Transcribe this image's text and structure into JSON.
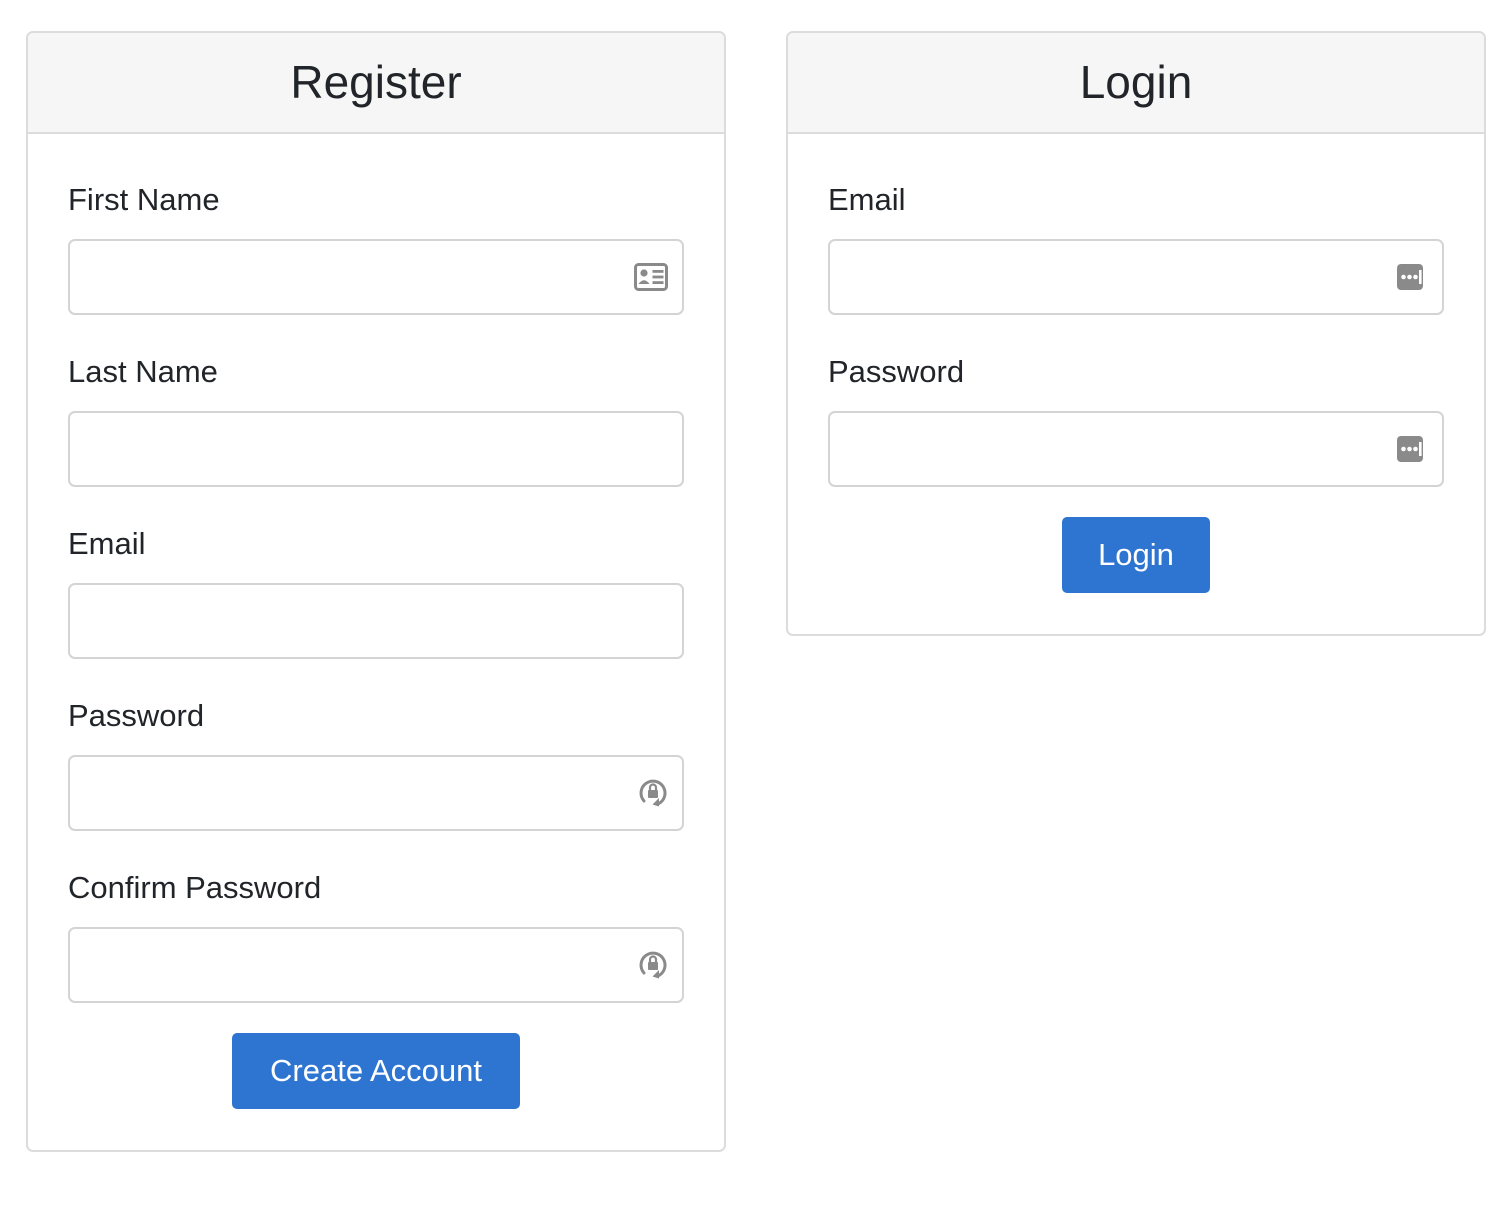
{
  "register": {
    "title": "Register",
    "fields": [
      {
        "label": "First Name",
        "value": "",
        "placeholder": "",
        "icon": "contact-card-icon"
      },
      {
        "label": "Last Name",
        "value": "",
        "placeholder": "",
        "icon": ""
      },
      {
        "label": "Email",
        "value": "",
        "placeholder": "",
        "icon": ""
      },
      {
        "label": "Password",
        "value": "",
        "placeholder": "",
        "icon": "password-generator-icon"
      },
      {
        "label": "Confirm Password",
        "value": "",
        "placeholder": "",
        "icon": "password-generator-icon"
      }
    ],
    "submit_label": "Create Account"
  },
  "login": {
    "title": "Login",
    "fields": [
      {
        "label": "Email",
        "value": "",
        "placeholder": "",
        "icon": "password-manager-icon"
      },
      {
        "label": "Password",
        "value": "",
        "placeholder": "",
        "icon": "password-manager-icon"
      }
    ],
    "submit_label": "Login"
  },
  "colors": {
    "primary": "#2e75d1",
    "card_header_bg": "#f6f6f7",
    "border": "#dcdcdc",
    "icon": "#8a8a8a"
  }
}
